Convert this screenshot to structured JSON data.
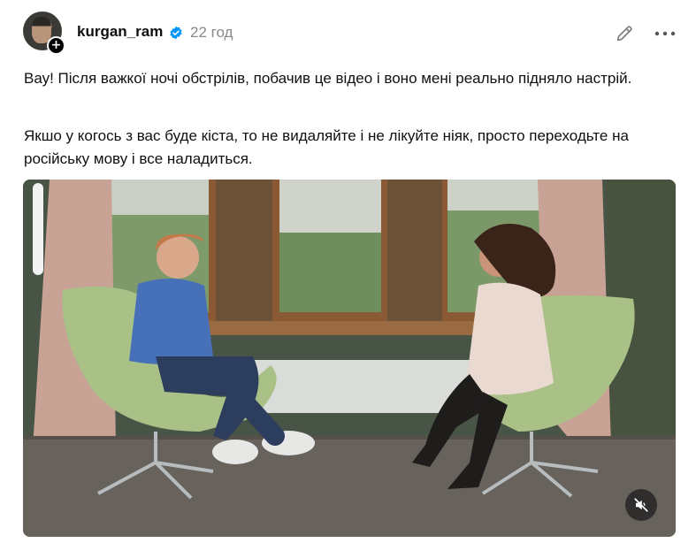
{
  "post": {
    "username": "kurgan_ram",
    "time": "22 год",
    "verified": true,
    "paragraphs": [
      "Вау! Після важкої ночі обстрілів, побачив це відео і воно мені реально підняло настрій.",
      "Якшо у когось з вас буде кіста, то не видаляйте і не лікуйте ніяк, просто переходьте на російську мову і все наладиться."
    ],
    "video": {
      "muted": true
    }
  },
  "icons": {
    "avatar_add": "plus-icon",
    "verified": "verified-badge-icon",
    "edit": "pencil-icon",
    "more": "more-icon",
    "mute": "speaker-muted-icon"
  },
  "colors": {
    "verified": "#0095f6",
    "muted_text": "#8a8a8a",
    "chair_green": "#a9c187",
    "wall_green": "#4d5a4a",
    "curtain": "#c8a294"
  }
}
